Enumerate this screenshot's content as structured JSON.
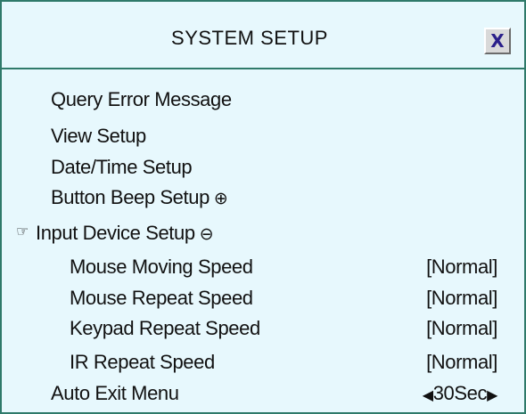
{
  "dialog": {
    "title": "SYSTEM SETUP",
    "close_label": "X"
  },
  "menu": {
    "query_error": "Query Error Message",
    "view_setup": "View Setup",
    "date_time_setup": "Date/Time Setup",
    "button_beep_setup": "Button Beep Setup",
    "button_beep_symbol": "⊕",
    "input_device_setup": "Input Device Setup",
    "input_device_symbol": "⊖",
    "selected_pointer": "☞",
    "mouse_moving_speed": {
      "label": "Mouse Moving Speed",
      "value": "[Normal]"
    },
    "mouse_repeat_speed": {
      "label": "Mouse Repeat Speed",
      "value": "[Normal]"
    },
    "keypad_repeat_speed": {
      "label": "Keypad Repeat Speed",
      "value": "[Normal]"
    },
    "ir_repeat_speed": {
      "label": "IR Repeat Speed",
      "value": "[Normal]"
    },
    "auto_exit_menu": {
      "label": "Auto Exit Menu",
      "value": "30Sec",
      "left_arrow": "◀",
      "right_arrow": "▶"
    }
  },
  "icons": {
    "close": "close-icon",
    "pointer": "hand-pointer-icon",
    "expand": "circle-plus-icon",
    "collapse": "circle-minus-icon",
    "decrease": "arrow-left-icon",
    "increase": "arrow-right-icon"
  },
  "colors": {
    "background": "#e7f8fd",
    "border": "#2f7a6a",
    "close_x": "#2a1f8a"
  }
}
